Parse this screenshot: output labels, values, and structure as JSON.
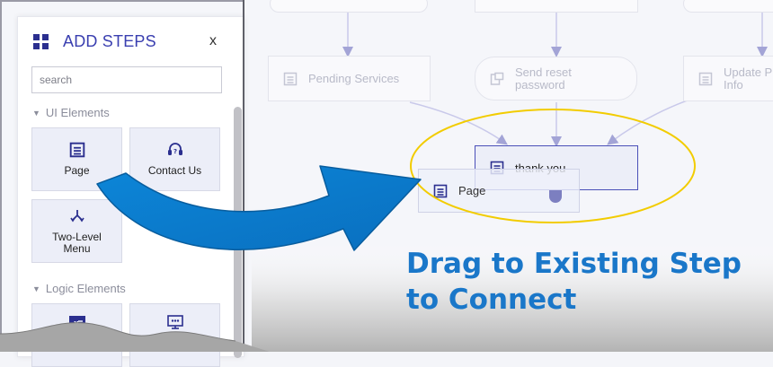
{
  "canvas": {
    "nodes": {
      "pending_services": "Pending Services",
      "send_reset_line1": "Send reset",
      "send_reset_line2": "password",
      "update_line1": "Update P",
      "update_line2": "Info",
      "thank_you": "thank you",
      "dragged_page": "Page"
    },
    "highlight_color": "#f2cc00",
    "arrow_color": "#0a7fd0"
  },
  "panel": {
    "title": "ADD STEPS",
    "close_label": "x",
    "search": {
      "placeholder": "search",
      "value": ""
    },
    "sections": [
      {
        "label": "UI Elements",
        "icon": "caret-down-icon"
      },
      {
        "label": "Logic Elements",
        "icon": "caret-down-icon"
      }
    ],
    "ui_elements": [
      {
        "label": "Page",
        "icon": "page-icon"
      },
      {
        "label": "Contact Us",
        "icon": "headset-icon"
      },
      {
        "label": "Two-Level\nMenu",
        "label_line1": "Two-Level",
        "label_line2": "Menu",
        "icon": "branch-icon"
      }
    ],
    "logic_elements": [
      {
        "icon": "variable-icon"
      },
      {
        "icon": "monitor-icon"
      }
    ]
  },
  "callout": {
    "line1": "Drag to Existing Step",
    "line2": "to Connect"
  },
  "colors": {
    "accent": "#3a3fb0",
    "callout_text": "#1a77c9",
    "tile_bg": "#eceef8"
  }
}
